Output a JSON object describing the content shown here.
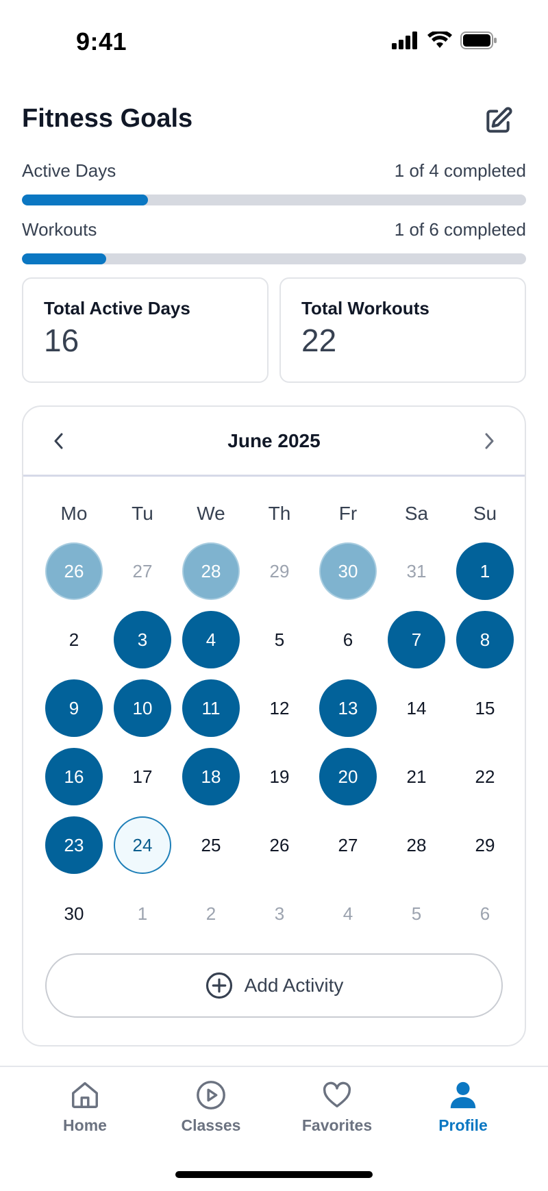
{
  "status_bar": {
    "time": "9:41"
  },
  "header": {
    "title": "Fitness Goals"
  },
  "goals": [
    {
      "label": "Active Days",
      "status": "1 of 4 completed",
      "progress": 0.25
    },
    {
      "label": "Workouts",
      "status": "1 of 6 completed",
      "progress": 0.1667
    }
  ],
  "stats": [
    {
      "label": "Total Active Days",
      "value": "16"
    },
    {
      "label": "Total Workouts",
      "value": "22"
    }
  ],
  "calendar": {
    "title": "June 2025",
    "weekdays": [
      "Mo",
      "Tu",
      "We",
      "Th",
      "Fr",
      "Sa",
      "Su"
    ],
    "weeks": [
      [
        {
          "d": "26",
          "s": "done-muted"
        },
        {
          "d": "27",
          "s": "muted"
        },
        {
          "d": "28",
          "s": "done-muted"
        },
        {
          "d": "29",
          "s": "muted"
        },
        {
          "d": "30",
          "s": "done-muted"
        },
        {
          "d": "31",
          "s": "muted"
        },
        {
          "d": "1",
          "s": "done"
        }
      ],
      [
        {
          "d": "2",
          "s": ""
        },
        {
          "d": "3",
          "s": "done"
        },
        {
          "d": "4",
          "s": "done"
        },
        {
          "d": "5",
          "s": ""
        },
        {
          "d": "6",
          "s": ""
        },
        {
          "d": "7",
          "s": "done"
        },
        {
          "d": "8",
          "s": "done"
        }
      ],
      [
        {
          "d": "9",
          "s": "done"
        },
        {
          "d": "10",
          "s": "done"
        },
        {
          "d": "11",
          "s": "done"
        },
        {
          "d": "12",
          "s": ""
        },
        {
          "d": "13",
          "s": "done"
        },
        {
          "d": "14",
          "s": ""
        },
        {
          "d": "15",
          "s": ""
        }
      ],
      [
        {
          "d": "16",
          "s": "done"
        },
        {
          "d": "17",
          "s": ""
        },
        {
          "d": "18",
          "s": "done"
        },
        {
          "d": "19",
          "s": ""
        },
        {
          "d": "20",
          "s": "done"
        },
        {
          "d": "21",
          "s": ""
        },
        {
          "d": "22",
          "s": ""
        }
      ],
      [
        {
          "d": "23",
          "s": "done"
        },
        {
          "d": "24",
          "s": "today"
        },
        {
          "d": "25",
          "s": ""
        },
        {
          "d": "26",
          "s": ""
        },
        {
          "d": "27",
          "s": ""
        },
        {
          "d": "28",
          "s": ""
        },
        {
          "d": "29",
          "s": ""
        }
      ],
      [
        {
          "d": "30",
          "s": ""
        },
        {
          "d": "1",
          "s": "muted"
        },
        {
          "d": "2",
          "s": "muted"
        },
        {
          "d": "3",
          "s": "muted"
        },
        {
          "d": "4",
          "s": "muted"
        },
        {
          "d": "5",
          "s": "muted"
        },
        {
          "d": "6",
          "s": "muted"
        }
      ]
    ],
    "add_label": "Add Activity"
  },
  "tabs": [
    {
      "label": "Home",
      "icon": "home-icon",
      "active": false
    },
    {
      "label": "Classes",
      "icon": "play-circle-icon",
      "active": false
    },
    {
      "label": "Favorites",
      "icon": "heart-icon",
      "active": false
    },
    {
      "label": "Profile",
      "icon": "user-icon",
      "active": true
    }
  ],
  "colors": {
    "accent": "#0b77c2",
    "completed_day": "#02629a",
    "completed_day_muted": "#7fb3cf"
  }
}
